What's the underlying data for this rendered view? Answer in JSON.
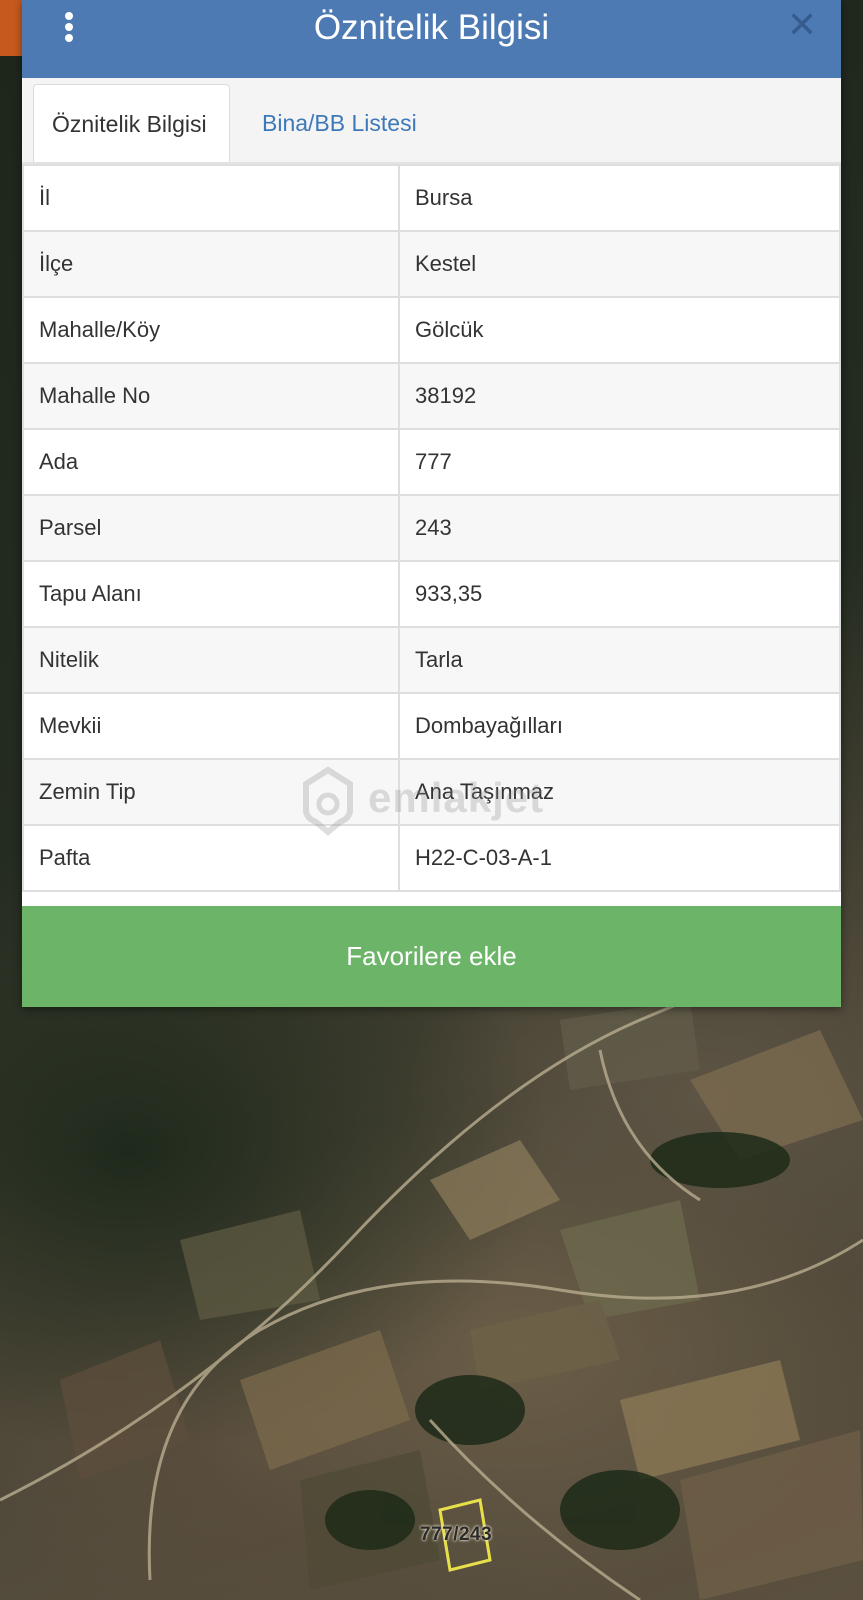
{
  "header": {
    "title": "Öznitelik Bilgisi",
    "menu_icon": "more-vertical-icon",
    "close_icon": "close-icon"
  },
  "tabs": [
    {
      "label": "Öznitelik Bilgisi",
      "active": true
    },
    {
      "label": "Bina/BB Listesi",
      "active": false
    }
  ],
  "attributes": [
    {
      "key": "İl",
      "value": "Bursa"
    },
    {
      "key": "İlçe",
      "value": "Kestel"
    },
    {
      "key": "Mahalle/Köy",
      "value": "Gölcük"
    },
    {
      "key": "Mahalle No",
      "value": "38192"
    },
    {
      "key": "Ada",
      "value": "777"
    },
    {
      "key": "Parsel",
      "value": "243"
    },
    {
      "key": "Tapu Alanı",
      "value": "933,35"
    },
    {
      "key": "Nitelik",
      "value": "Tarla"
    },
    {
      "key": "Mevkii",
      "value": "Dombayağılları"
    },
    {
      "key": "Zemin Tip",
      "value": "Ana Taşınmaz"
    },
    {
      "key": "Pafta",
      "value": "H22-C-03-A-1"
    }
  ],
  "actions": {
    "favorite_label": "Favorilere ekle"
  },
  "watermark": {
    "text": "emlakjet"
  },
  "map": {
    "parcel_label": "777/243"
  },
  "colors": {
    "header_bg": "#4d7ab3",
    "tab_link": "#3d78b8",
    "button_bg": "#6cb468"
  }
}
